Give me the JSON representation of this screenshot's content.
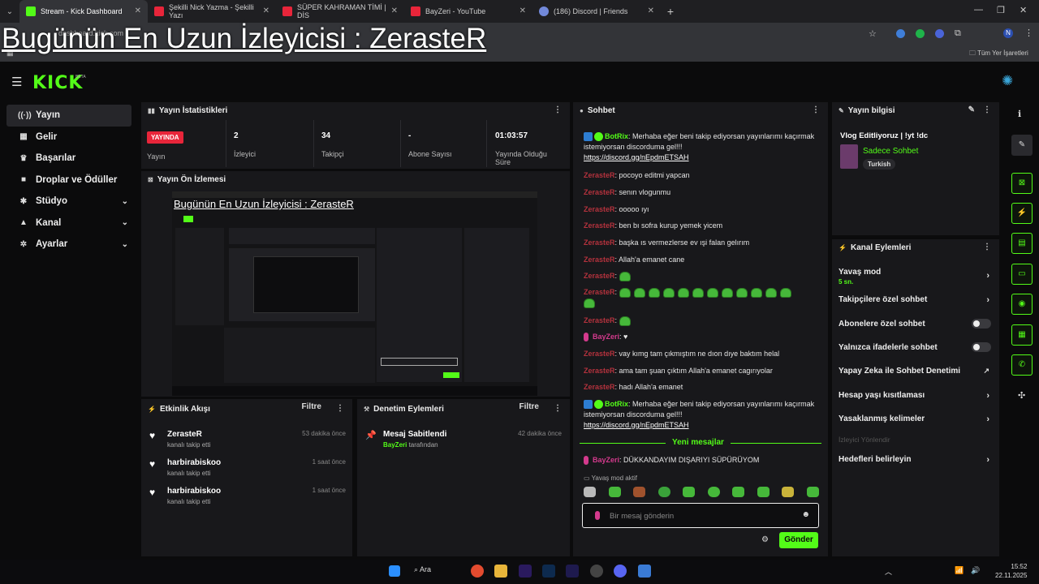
{
  "browser": {
    "tabs": [
      {
        "label": "Stream - Kick Dashboard",
        "color": "#53fc18"
      },
      {
        "label": "Şekilli Nick Yazma - Şekilli Yazı",
        "color": "#e8253a"
      },
      {
        "label": "SÜPER KAHRAMAN TİMİ | DİS",
        "color": "#e8253a"
      },
      {
        "label": "BayZeri - YouTube",
        "color": "#e8253a"
      },
      {
        "label": "(186) Discord | Friends",
        "color": "#7289da"
      }
    ],
    "bookmarks_label": "Tüm Yer İşaretleri",
    "url_fragment": "dashboard.kick.com"
  },
  "overlay": {
    "title": "Bugünün En Uzun İzleyicisi : ZerasteR"
  },
  "header": {
    "logo": "KICK",
    "beta": "BETA"
  },
  "sidebar": {
    "items": [
      {
        "icon": "((·))",
        "label": "Yayın",
        "expandable": false
      },
      {
        "icon": "▦",
        "label": "Gelir",
        "expandable": false
      },
      {
        "icon": "♛",
        "label": "Başarılar",
        "expandable": false
      },
      {
        "icon": "■",
        "label": "Droplar ve Ödüller",
        "expandable": false
      },
      {
        "icon": "✱",
        "label": "Stüdyo",
        "expandable": true
      },
      {
        "icon": "▲",
        "label": "Kanal",
        "expandable": true
      },
      {
        "icon": "✲",
        "label": "Ayarlar",
        "expandable": true
      }
    ]
  },
  "stats_panel": {
    "title": "Yayın İstatistikleri",
    "live_badge": "YAYINDA",
    "live_label": "Yayın",
    "viewers_value": "2",
    "viewers_label": "İzleyici",
    "followers_value": "34",
    "followers_label": "Takipçi",
    "subs_value": "-",
    "subs_label": "Abone Sayısı",
    "duration_value": "01:03:57",
    "duration_label_1": "Yayında Olduğu",
    "duration_label_2": "Süre"
  },
  "preview_panel": {
    "title": "Yayın Ön İzlemesi",
    "overlay_text": "Bugünün En Uzun İzleyicisi : ZerasteR"
  },
  "activity_panel": {
    "title": "Etkinlik Akışı",
    "filter_label": "Filtre",
    "items": [
      {
        "name": "ZerasteR",
        "sub": "kanalı takip etti",
        "time": "53 dakika önce"
      },
      {
        "name": "harbirabiskoo",
        "sub": "kanalı takip etti",
        "time": "1 saat önce"
      },
      {
        "name": "harbirabiskoo",
        "sub": "kanalı takip etti",
        "time": "1 saat önce"
      }
    ]
  },
  "moderation_panel": {
    "title": "Denetim Eylemleri",
    "filter_label": "Filtre",
    "item_title": "Mesaj Sabitlendi",
    "item_user": "BayZeri",
    "item_suffix": " tarafından",
    "item_time": "42 dakika önce"
  },
  "chat": {
    "title": "Sohbet",
    "botrix_name": "BotRix",
    "botrix_text": ": Merhaba eğer beni takip ediyorsan yayınlarımı kaçırmak istemiyorsan discorduma gel!!!",
    "botrix_link": "https://discord.gg/nEpdmETSAH",
    "zerasteR": "ZerasteR",
    "bayzeri": "BayZeri",
    "messages": [
      ": pocoyo editmi yapcan",
      ": senın vlogunmu",
      ": ooooo ıyı",
      ": ben bı sofra kurup yemek yicem",
      ": başka ıs vermezlerse ev ışi falan gelırım",
      ": Allah'a emanet cane"
    ],
    "bayzeri_heart": ": ♥",
    "later_messages": [
      ": vay kımg tam çıkmıştım ne dıon dıye baktım helal",
      ": ama tam şuan çıktım Allah'a emanet cagırıyolar",
      ": hadı Allah'a emanet"
    ],
    "new_messages_label": "Yeni mesajlar",
    "bayzeri_message": ": DÜKKANDAYIM DIŞARIYI SÜPÜRÜYOM",
    "slow_mode_note": "Yavaş mod aktif",
    "input_placeholder": "Bir mesaj gönderin",
    "send_label": "Gönder"
  },
  "stream_info": {
    "title": "Yayın bilgisi",
    "stream_title": "Vlog Editliyoruz | !yt !dc",
    "category": "Sadece Sohbet",
    "language_tag": "Turkish"
  },
  "channel_actions": {
    "title": "Kanal Eylemleri",
    "items": [
      {
        "label": "Yavaş mod",
        "sub": "5 sn.",
        "control": "chevron"
      },
      {
        "label": "Takipçilere özel sohbet",
        "control": "chevron"
      },
      {
        "label": "Abonelere özel sohbet",
        "control": "toggle"
      },
      {
        "label": "Yalnızca ifadelerle sohbet",
        "control": "toggle"
      },
      {
        "label": "Yapay Zeka ile Sohbet Denetimi",
        "control": "external"
      },
      {
        "label": "Hesap yaşı kısıtlaması",
        "control": "chevron"
      },
      {
        "label": "Yasaklanmış kelimeler",
        "control": "chevron"
      },
      {
        "label": "Hedefleri belirleyin",
        "control": "chevron"
      }
    ],
    "faded_label": "İzleyici Yönlendir"
  },
  "taskbar": {
    "search_label": "Ara",
    "time": "15:52",
    "date": "22.11.2025"
  },
  "colors": {
    "accent": "#53fc18",
    "live_red": "#e8253a",
    "panel_bg": "#18181b",
    "page_bg": "#0b0b0c"
  }
}
